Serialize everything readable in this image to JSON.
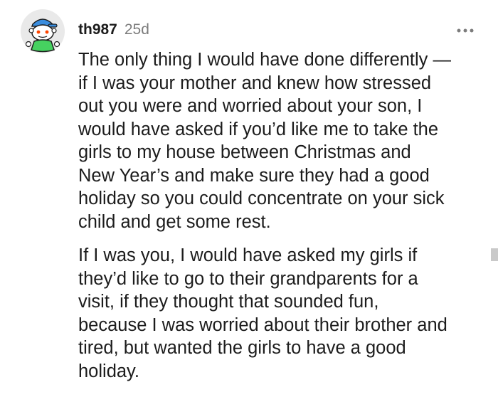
{
  "comment": {
    "author": "th987",
    "age": "25d",
    "more_icon": "more-dots-icon",
    "avatar_icon": "snoo-avatar-icon",
    "paragraphs": [
      {
        "lines": [
          "The only thing I would have done differently —",
          "if I was your mother and knew how stressed",
          "out you were and worried about your son, I",
          "would have asked if you’d like me to take the",
          "girls to my house between Christmas and",
          "New Year’s and make sure they had a good",
          "holiday so you could concentrate on your sick",
          "child and get some rest."
        ]
      },
      {
        "lines": [
          "If I was you, I would have asked my girls if",
          "they’d like to go to their grandparents for a",
          "visit, if they thought that sounded fun,",
          "because I was worried about their brother and",
          "tired, but wanted the girls to have a good",
          "holiday."
        ]
      }
    ]
  },
  "colors": {
    "text": "#1c1c1c",
    "meta": "#7c7c7c",
    "avatar_bg": "#3a8dde",
    "avatar_face": "#ffffff",
    "avatar_shirt": "#46d160"
  }
}
